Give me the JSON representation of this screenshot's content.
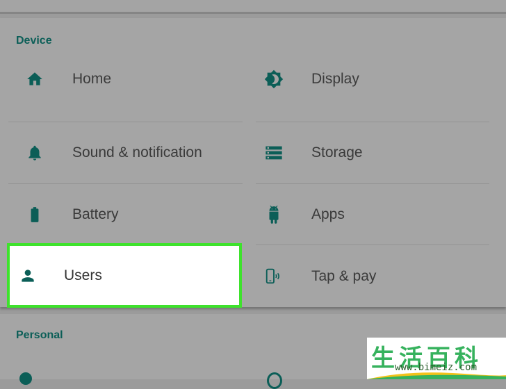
{
  "sections": {
    "device": "Device",
    "personal": "Personal"
  },
  "device_items": {
    "home": {
      "label": "Home",
      "icon": "home-icon"
    },
    "display": {
      "label": "Display",
      "icon": "brightness-icon"
    },
    "sound": {
      "label": "Sound & notification",
      "icon": "bell-icon"
    },
    "storage": {
      "label": "Storage",
      "icon": "storage-icon"
    },
    "battery": {
      "label": "Battery",
      "icon": "battery-icon"
    },
    "apps": {
      "label": "Apps",
      "icon": "android-icon"
    },
    "users": {
      "label": "Users",
      "icon": "person-icon",
      "highlighted": true
    },
    "tap_pay": {
      "label": "Tap & pay",
      "icon": "phone-nfc-icon"
    }
  },
  "watermark": {
    "chars": "生活百科",
    "url": "www.bimeiz.com"
  },
  "colors": {
    "accent": "#0b5e57",
    "highlight_border": "#3ee22c",
    "background": "#a5a5a5"
  }
}
